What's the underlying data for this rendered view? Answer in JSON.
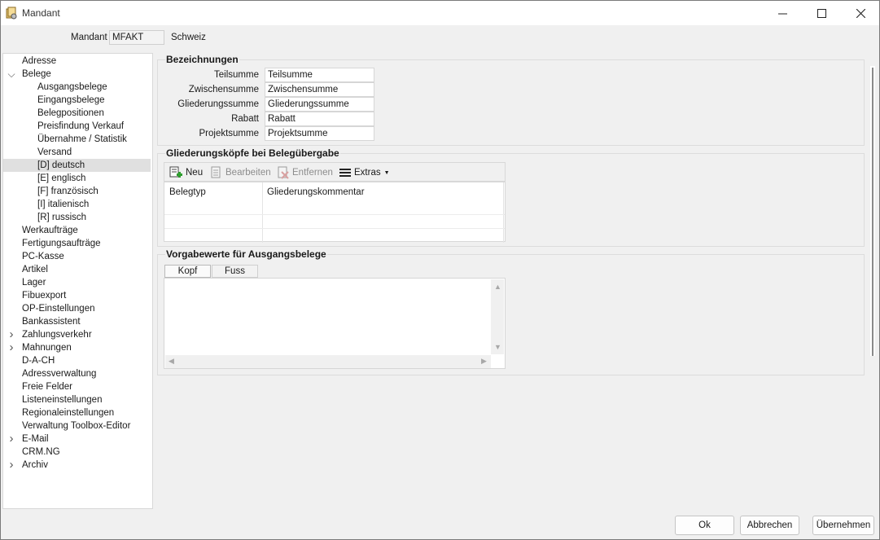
{
  "window": {
    "title": "Mandant",
    "minimize": "—",
    "maximize": "☐",
    "close": "✕"
  },
  "mandant": {
    "label": "Mandant",
    "value": "MFAKT",
    "name": "Schweiz"
  },
  "tree": [
    {
      "label": "Adresse"
    },
    {
      "label": "Belege",
      "arrow": "expanded"
    },
    {
      "label": "Ausgangsbelege"
    },
    {
      "label": "Eingangsbelege"
    },
    {
      "label": "Belegpositionen"
    },
    {
      "label": "Preisfindung Verkauf"
    },
    {
      "label": "Übernahme / Statistik"
    },
    {
      "label": "Versand"
    },
    {
      "label": "[D]  deutsch",
      "selected": true
    },
    {
      "label": "[E]  englisch"
    },
    {
      "label": "[F]  französisch"
    },
    {
      "label": "[I]  italienisch"
    },
    {
      "label": "[R]  russisch"
    },
    {
      "label": "Werkaufträge"
    },
    {
      "label": "Fertigungsaufträge"
    },
    {
      "label": "PC-Kasse"
    },
    {
      "label": "Artikel"
    },
    {
      "label": "Lager"
    },
    {
      "label": "Fibuexport"
    },
    {
      "label": "OP-Einstellungen"
    },
    {
      "label": "Bankassistent"
    },
    {
      "label": "Zahlungsverkehr",
      "arrow": "collapsed"
    },
    {
      "label": "Mahnungen",
      "arrow": "collapsed"
    },
    {
      "label": "D-A-CH"
    },
    {
      "label": "Adressverwaltung"
    },
    {
      "label": "Freie Felder"
    },
    {
      "label": "Listeneinstellungen"
    },
    {
      "label": "Regionaleinstellungen"
    },
    {
      "label": "Verwaltung Toolbox-Editor"
    },
    {
      "label": "E-Mail",
      "arrow": "collapsed"
    },
    {
      "label": "CRM.NG"
    },
    {
      "label": "Archiv",
      "arrow": "collapsed"
    }
  ],
  "bezeichnungen": {
    "title": "Bezeichnungen",
    "rows": [
      {
        "label": "Teilsumme",
        "value": "Teilsumme"
      },
      {
        "label": "Zwischensumme",
        "value": "Zwischensumme"
      },
      {
        "label": "Gliederungssumme",
        "value": "Gliederungssumme"
      },
      {
        "label": "Rabatt",
        "value": "Rabatt"
      },
      {
        "label": "Projektsumme",
        "value": "Projektsumme"
      }
    ]
  },
  "gliederung": {
    "title": "Gliederungsköpfe bei Belegübergabe",
    "toolbar": {
      "new": "Neu",
      "edit": "Bearbeiten",
      "remove": "Entfernen",
      "extras": "Extras"
    },
    "columns": [
      "Belegtyp",
      "Gliederungskommentar"
    ]
  },
  "vorgabe": {
    "title": "Vorgabewerte für Ausgangsbelege",
    "tabs": [
      "Kopf",
      "Fuss"
    ]
  },
  "footer": {
    "ok": "Ok",
    "cancel": "Abbrechen",
    "apply": "Übernehmen"
  },
  "colors": {
    "new_icon_plus": "#2e9e2e",
    "remove_icon": "#c0392b",
    "selection": "#e0e0e0"
  }
}
